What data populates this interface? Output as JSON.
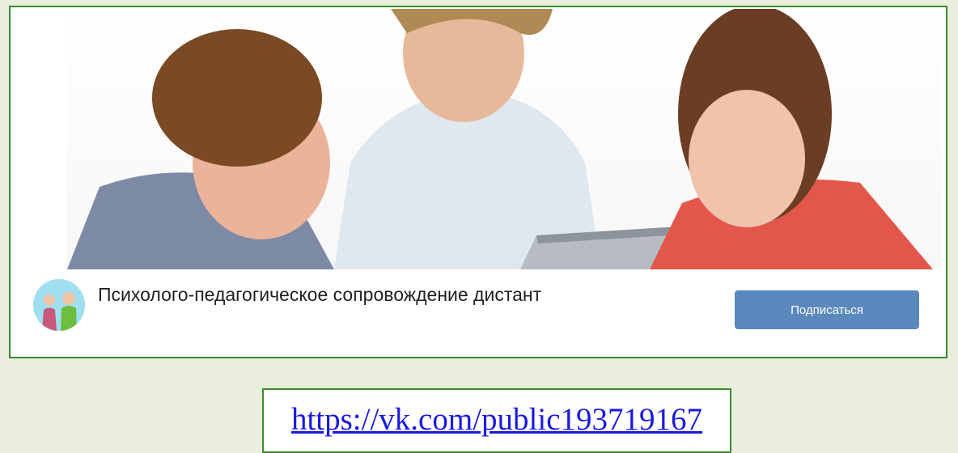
{
  "group": {
    "name": "Психолого-педагогическое сопровождение дистант",
    "subscribe_label": "Подписаться",
    "cover_image": "children-with-teacher-at-laptop",
    "avatar_image": "teacher-and-child-illustration"
  },
  "link": {
    "text": "https://vk.com/public193719167"
  },
  "colors": {
    "background": "#e9efdc",
    "border": "#3d8a30",
    "button": "#5b88bd",
    "link": "#1a1ae0"
  }
}
